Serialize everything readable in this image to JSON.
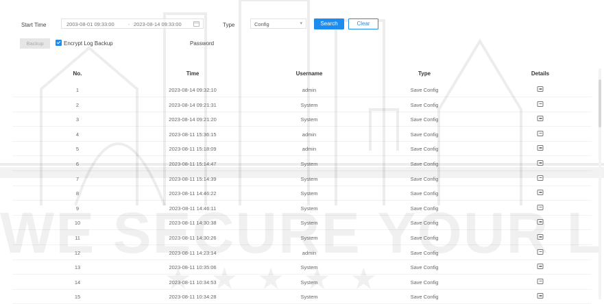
{
  "filters": {
    "start_time_label": "Start Time",
    "start_time_from": "2003-08-01 09:33:00",
    "start_time_separator": "-",
    "start_time_to": "2023-08-14 09:33:00",
    "type_label": "Type",
    "type_value": "Config",
    "search_label": "Search",
    "clear_label": "Clear"
  },
  "backup": {
    "backup_label": "Backup",
    "encrypt_label": "Encrypt Log Backup",
    "encrypt_checked": true,
    "password_label": "Password"
  },
  "table": {
    "columns": [
      "No.",
      "Time",
      "Username",
      "Type",
      "Details"
    ],
    "rows": [
      {
        "no": "1",
        "time": "2023-08-14 09:32:10",
        "username": "admin",
        "type": "Save Config"
      },
      {
        "no": "2",
        "time": "2023-08-14 09:21:31",
        "username": "System",
        "type": "Save Config"
      },
      {
        "no": "3",
        "time": "2023-08-14 09:21:20",
        "username": "System",
        "type": "Save Config"
      },
      {
        "no": "4",
        "time": "2023-08-11 15:36:15",
        "username": "admin",
        "type": "Save Config"
      },
      {
        "no": "5",
        "time": "2023-08-11 15:18:09",
        "username": "admin",
        "type": "Save Config"
      },
      {
        "no": "6",
        "time": "2023-08-11 15:14:47",
        "username": "System",
        "type": "Save Config"
      },
      {
        "no": "7",
        "time": "2023-08-11 15:14:39",
        "username": "System",
        "type": "Save Config"
      },
      {
        "no": "8",
        "time": "2023-08-11 14:46:22",
        "username": "System",
        "type": "Save Config"
      },
      {
        "no": "9",
        "time": "2023-08-11 14:46:11",
        "username": "System",
        "type": "Save Config"
      },
      {
        "no": "10",
        "time": "2023-08-11 14:30:38",
        "username": "System",
        "type": "Save Config"
      },
      {
        "no": "11",
        "time": "2023-08-11 14:30:26",
        "username": "System",
        "type": "Save Config"
      },
      {
        "no": "12",
        "time": "2023-08-11 14:23:14",
        "username": "admin",
        "type": "Save Config"
      },
      {
        "no": "13",
        "time": "2023-08-11 10:35:06",
        "username": "System",
        "type": "Save Config"
      },
      {
        "no": "14",
        "time": "2023-08-11 10:34:53",
        "username": "System",
        "type": "Save Config"
      },
      {
        "no": "15",
        "time": "2023-08-11 10:34:28",
        "username": "System",
        "type": "Save Config"
      }
    ]
  },
  "watermark": {
    "text": "WE SECURE YOUR LIFE",
    "stars": "★ ★ ★ ★ ★"
  },
  "colors": {
    "accent": "#1e8cee",
    "disabled_button": "#e6e6e6"
  },
  "icons": {
    "details": "details-icon",
    "calendar": "calendar-icon",
    "dropdown": "chevron-down-icon",
    "checkbox": "checkbox-checked-icon"
  }
}
